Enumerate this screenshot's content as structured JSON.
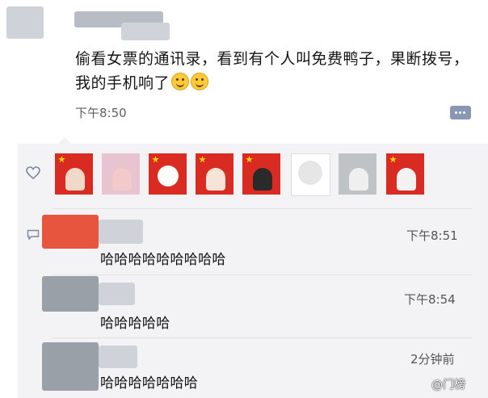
{
  "post": {
    "text": "偷看女票的通讯录，看到有个人叫免费鸭子，果断拨号，我的手机响了",
    "emojis": [
      "smile-emoji",
      "smile-emoji"
    ],
    "time": "下午8:50"
  },
  "likes": {
    "icon": "heart-icon",
    "avatars": [
      {
        "name": "avatar-flag-girl-sketch",
        "face": "#f1d9c8"
      },
      {
        "name": "avatar-girl-pink",
        "face": "#f3c9c9"
      },
      {
        "name": "avatar-flag-smiley",
        "face": "#ffffff"
      },
      {
        "name": "avatar-flag-cat",
        "face": "#f7e4d8"
      },
      {
        "name": "avatar-flag-silhouette",
        "face": "#2a2a2a"
      },
      {
        "name": "avatar-meme-face",
        "face": "#f0f0f0"
      },
      {
        "name": "avatar-woman-portrait",
        "face": "#c9c9c9"
      },
      {
        "name": "avatar-flag-girl-white",
        "face": "#f2f2f2"
      }
    ]
  },
  "comments": [
    {
      "time": "下午8:51",
      "text": "哈哈哈哈哈哈哈哈哈"
    },
    {
      "time": "下午8:54",
      "text": "哈哈哈哈哈"
    },
    {
      "time": "2分钟前",
      "text": "哈哈哈哈哈哈哈"
    }
  ],
  "watermark": "@门榜",
  "colors": {
    "flag_red": "#d92b22",
    "panel_bg": "#f3f3f5",
    "link_blue": "#8a97b4"
  }
}
